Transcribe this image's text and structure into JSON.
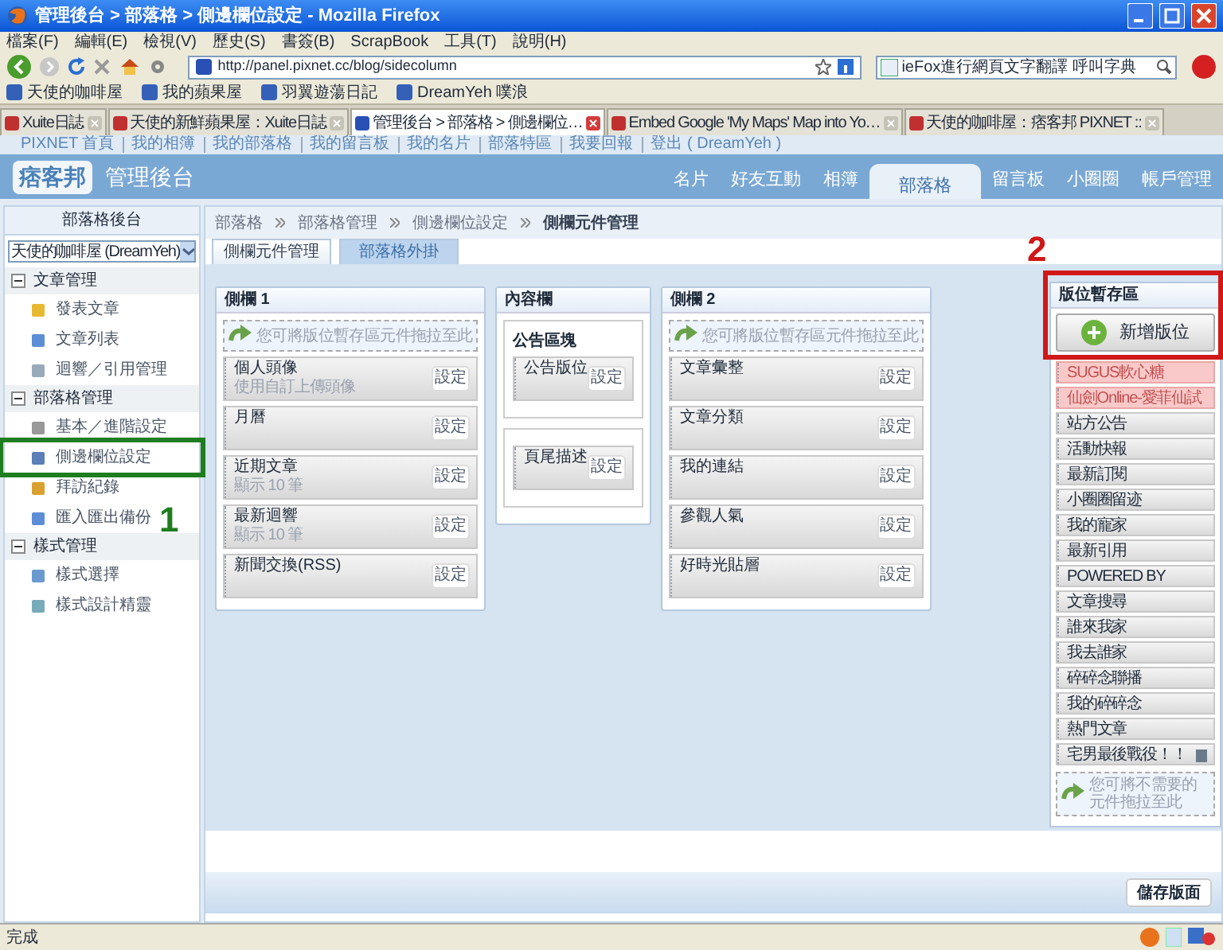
{
  "window": {
    "title": "管理後台 > 部落格 > 側邊欄位設定 - Mozilla Firefox"
  },
  "menu_bar": [
    "檔案(F)",
    "編輯(E)",
    "檢視(V)",
    "歷史(S)",
    "書簽(B)",
    "ScrapBook",
    "工具(T)",
    "說明(H)"
  ],
  "nav_toolbar": {
    "url": "http://panel.pixnet.cc/blog/sidecolumn",
    "search_value": "ieFox進行網頁文字翻譯 呼叫字典"
  },
  "bookmarks": [
    "天使的咖啡屋",
    "我的蘋果屋",
    "羽翼遊蕩日記",
    "DreamYeh 噗浪"
  ],
  "tabs": [
    {
      "label": "Xuite日誌",
      "selected": false
    },
    {
      "label": "天使的新鮮蘋果屋：Xuite日誌",
      "selected": false
    },
    {
      "label": "管理後台 > 部落格 > 側邊欄位…",
      "selected": true
    },
    {
      "label": "Embed Google 'My Maps' Map into Yo…",
      "selected": false
    },
    {
      "label": "天使的咖啡屋：痞客邦 PIXNET ::",
      "selected": false
    }
  ],
  "pixnet_links": [
    "PIXNET 首頁",
    "我的相簿",
    "我的部落格",
    "我的留言板",
    "我的名片",
    "部落特區",
    "我要回報",
    "登出 ( DreamYeh )"
  ],
  "header": {
    "logo": "痞客邦",
    "title": "管理後台",
    "nav": [
      {
        "label": "名片",
        "selected": false
      },
      {
        "label": "好友互動",
        "selected": false
      },
      {
        "label": "相簿",
        "selected": false
      },
      {
        "label": "部落格",
        "selected": true
      },
      {
        "label": "留言板",
        "selected": false
      },
      {
        "label": "小圈圈",
        "selected": false
      },
      {
        "label": "帳戶管理",
        "selected": false
      }
    ]
  },
  "sidebar": {
    "heading": "部落格後台",
    "blog_select": "天使的咖啡屋 (DreamYeh)",
    "sections": [
      {
        "title": "文章管理",
        "expanded": true,
        "items": [
          "發表文章",
          "文章列表",
          "迴響／引用管理"
        ]
      },
      {
        "title": "部落格管理",
        "expanded": true,
        "items": [
          "基本／進階設定",
          "側邊欄位設定",
          "拜訪紀錄",
          "匯入匯出備份"
        ]
      },
      {
        "title": "樣式管理",
        "expanded": true,
        "items": [
          "樣式選擇",
          "樣式設計精靈"
        ]
      }
    ]
  },
  "breadcrumb": [
    "部落格",
    "部落格管理",
    "側邊欄位設定",
    "側欄元件管理"
  ],
  "page_tabs": [
    {
      "label": "側欄元件管理",
      "selected": true
    },
    {
      "label": "部落格外掛",
      "selected": false
    }
  ],
  "side_column_1": {
    "title": "側欄 1",
    "drop_hint": "您可將版位暫存區元件拖拉至此",
    "widgets": [
      {
        "name": "個人頭像",
        "detail": "使用自訂上傳頭像",
        "button": "設定"
      },
      {
        "name": "月曆",
        "button": "設定"
      },
      {
        "name": "近期文章",
        "detail": "顯示 10 筆",
        "button": "設定"
      },
      {
        "name": "最新迴響",
        "detail": "顯示 10 筆",
        "button": "設定"
      },
      {
        "name": "新聞交換(RSS)",
        "button": "設定"
      }
    ]
  },
  "content_column": {
    "title": "內容欄",
    "groups": [
      {
        "title": "公告區塊",
        "widgets": [
          {
            "name": "公告版位",
            "button": "設定"
          }
        ]
      },
      {
        "widgets": [
          {
            "name": "頁尾描述",
            "button": "設定"
          }
        ]
      }
    ]
  },
  "side_column_2": {
    "title": "側欄 2",
    "drop_hint": "您可將版位暫存區元件拖拉至此",
    "widgets": [
      {
        "name": "文章彙整",
        "button": "設定"
      },
      {
        "name": "文章分類",
        "button": "設定"
      },
      {
        "name": "我的連結",
        "button": "設定"
      },
      {
        "name": "參觀人氣",
        "button": "設定"
      },
      {
        "name": "好時光貼層",
        "button": "設定"
      }
    ]
  },
  "storage": {
    "title": "版位暫存區",
    "add_button": "新增版位",
    "items": [
      {
        "label": "SUGUS軟心糖",
        "highlighted": true,
        "trash": false
      },
      {
        "label": "仙劍Online-愛菲仙試",
        "highlighted": true,
        "trash": false
      },
      {
        "label": "站方公告",
        "highlighted": false,
        "trash": false
      },
      {
        "label": "活動快報",
        "highlighted": false,
        "trash": false
      },
      {
        "label": "最新訂閱",
        "highlighted": false,
        "trash": false
      },
      {
        "label": "小圈圈留迹",
        "highlighted": false,
        "trash": false
      },
      {
        "label": "我的寵家",
        "highlighted": false,
        "trash": false
      },
      {
        "label": "最新引用",
        "highlighted": false,
        "trash": false
      },
      {
        "label": "POWERED BY",
        "highlighted": false,
        "trash": false
      },
      {
        "label": "文章搜尋",
        "highlighted": false,
        "trash": false
      },
      {
        "label": "誰來我家",
        "highlighted": false,
        "trash": false
      },
      {
        "label": "我去誰家",
        "highlighted": false,
        "trash": false
      },
      {
        "label": "碎碎念聯播",
        "highlighted": false,
        "trash": false
      },
      {
        "label": "我的碎碎念",
        "highlighted": false,
        "trash": false
      },
      {
        "label": "熱門文章",
        "highlighted": false,
        "trash": false
      },
      {
        "label": "宅男最後戰役！！",
        "highlighted": false,
        "trash": true
      }
    ],
    "drop_hint": "您可將不需要的元件拖拉至此"
  },
  "save_button": "儲存版面",
  "annotations": [
    {
      "label": "1",
      "color": "#1e7d1e"
    },
    {
      "label": "2",
      "color": "#d01818"
    }
  ],
  "status_bar": "完成"
}
